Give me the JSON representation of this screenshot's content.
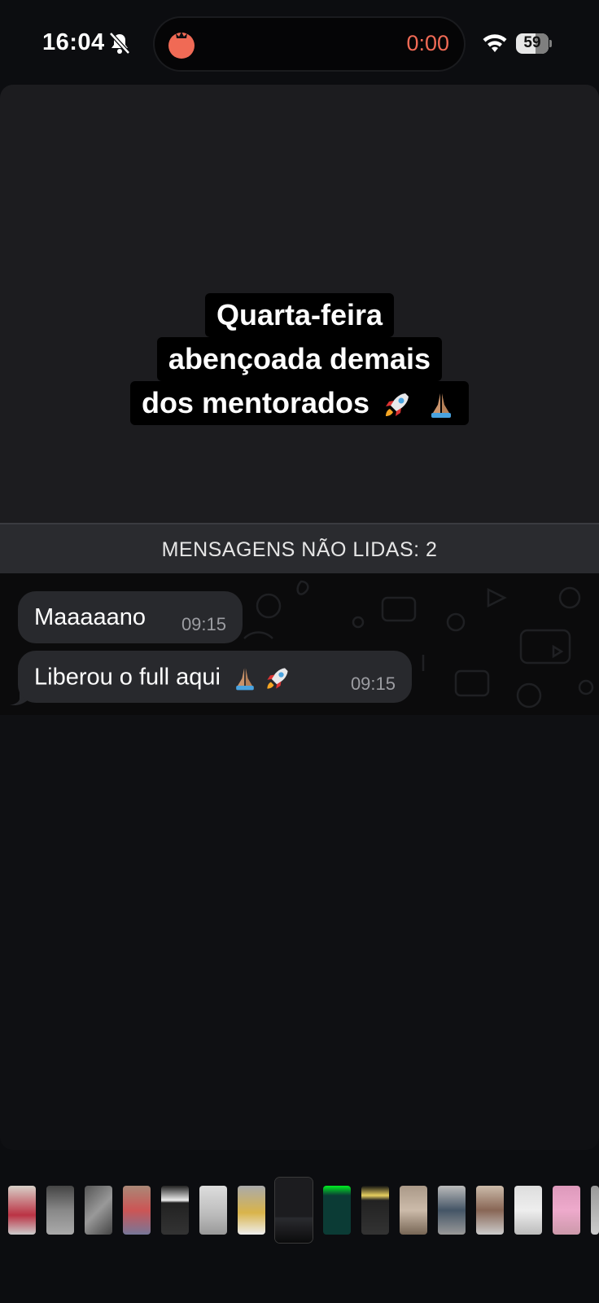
{
  "status_bar": {
    "time": "16:04",
    "timer": "0:00",
    "battery": "59"
  },
  "story": {
    "headline_lines": [
      "Quarta-feira",
      "abençoada demais",
      "dos mentorados"
    ]
  },
  "chat": {
    "unread_label": "MENSAGENS NÃO LIDAS: 2",
    "messages": [
      {
        "text": "Maaaaano",
        "time": "09:15"
      },
      {
        "text": "Liberou o full aqui",
        "time": "09:15"
      }
    ]
  },
  "colors": {
    "accent_tomato": "#f06a55",
    "bubble": "#28292d",
    "unread_bar": "#2a2b2f"
  },
  "thumbnails": {
    "count": 17,
    "active_index": 7
  }
}
